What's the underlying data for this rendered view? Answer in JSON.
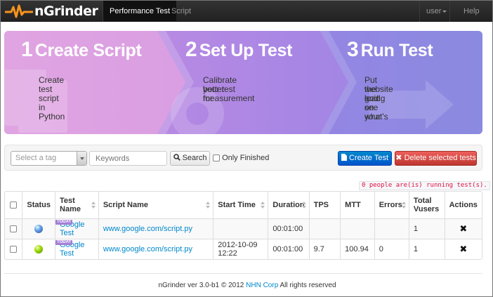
{
  "navbar": {
    "brand": "nGrinder",
    "items": [
      {
        "label": "Performance Test",
        "active": true
      },
      {
        "label": "Script",
        "active": false
      }
    ],
    "user_label": "user",
    "help_label": "Help"
  },
  "banner": {
    "steps": [
      {
        "num": "1",
        "title": "Create Script",
        "desc": [
          "Create test script in Python"
        ]
      },
      {
        "num": "2",
        "title": "Set Up Test",
        "desc": [
          "Calibrate your test for",
          "better measurement"
        ]
      },
      {
        "num": "3",
        "title": "Run Test",
        "desc": [
          "Put the load on your",
          "website and see what's",
          "going on."
        ]
      }
    ]
  },
  "toolbar": {
    "tag_placeholder": "Select a tag",
    "keywords_placeholder": "Keywords",
    "search_label": "Search",
    "only_finished_label": "Only Finished",
    "create_label": "Create Test",
    "delete_label": "Delete selected tests"
  },
  "running_notice": "0 people are(is) running test(s).",
  "table": {
    "headers": [
      "Status",
      "Test Name",
      "Script Name",
      "Start Time",
      "Duration",
      "TPS",
      "MTT",
      "Errors",
      "Total Vusers",
      "Actions"
    ],
    "rows": [
      {
        "badge": "TODAY",
        "status": "blue",
        "test_name": "Google Test",
        "script": "www.google.com/script.py",
        "start": "",
        "duration": "00:01:00",
        "tps": "",
        "mtt": "",
        "errors": "",
        "vusers": "1"
      },
      {
        "badge": "TODAY",
        "status": "green",
        "test_name": "Google Test",
        "script": "www.google.com/script.py",
        "start": "2012-10-09 12:22",
        "duration": "00:01:00",
        "tps": "9.7",
        "mtt": "100.94",
        "errors": "0",
        "vusers": "1"
      }
    ]
  },
  "footer": {
    "prefix": "nGrinder ver 3.0-b1 © 2012",
    "company": "NHN Corp",
    "suffix": "All rights reserved"
  },
  "colors": {
    "banner_start": "#d99bdf",
    "banner_end": "#8b89e2",
    "create_button": "#0088cc",
    "delete_button": "#da4f49",
    "link": "#0088cc"
  }
}
